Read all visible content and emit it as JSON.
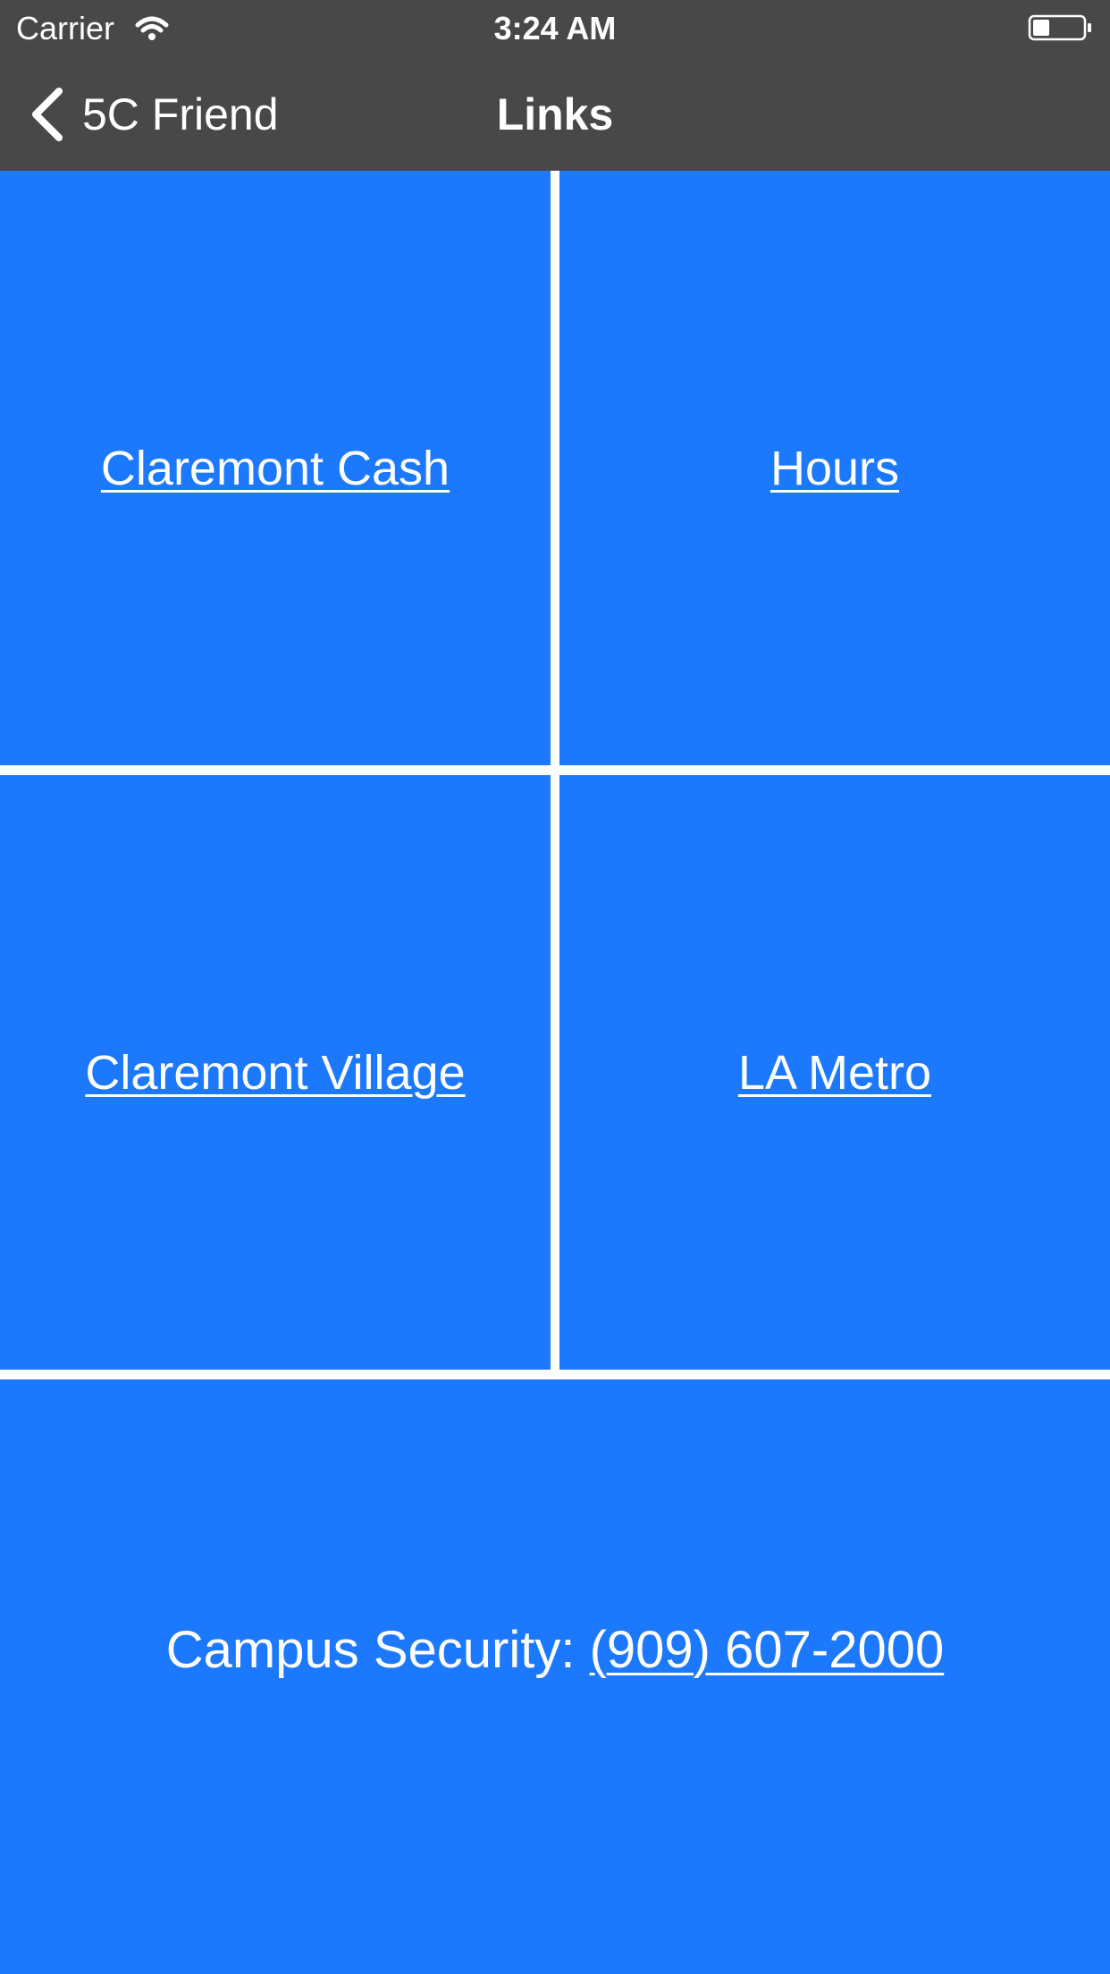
{
  "status_bar": {
    "carrier": "Carrier",
    "time": "3:24 AM",
    "wifi_icon": "wifi-icon",
    "battery_icon": "battery-icon"
  },
  "nav": {
    "back_label": "5C Friend",
    "title": "Links",
    "back_icon": "chevron-left-icon"
  },
  "tiles": [
    {
      "label": "Claremont Cash"
    },
    {
      "label": "Hours"
    },
    {
      "label": "Claremont Village"
    },
    {
      "label": "LA Metro"
    }
  ],
  "security": {
    "prefix": "Campus Security:",
    "phone": "(909) 607-2000"
  },
  "colors": {
    "navbar": "#484848",
    "tile": "#1c79fe",
    "separator": "#ffffff",
    "text": "#ffffff"
  }
}
